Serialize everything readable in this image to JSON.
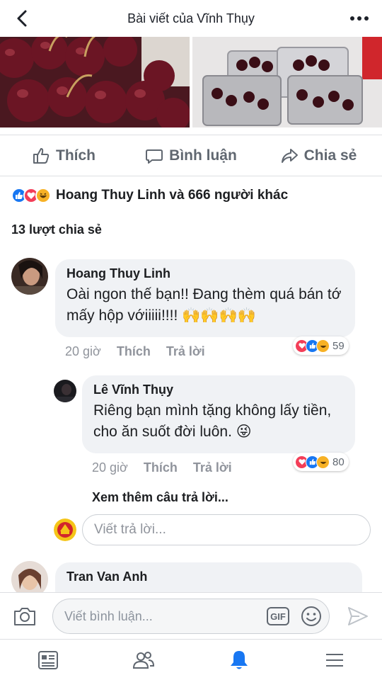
{
  "header": {
    "title": "Bài viết của Vĩnh Thụy"
  },
  "post": {
    "photos": [
      "cherries-closeup",
      "cherries-in-boxes"
    ],
    "actions": {
      "like_label": "Thích",
      "comment_label": "Bình luận",
      "share_label": "Chia sẻ"
    },
    "reactions_summary": "Hoang Thuy Linh và 666 người khác",
    "shares_text": "13 lượt chia sẻ"
  },
  "comments": [
    {
      "author": "Hoang Thuy Linh",
      "text": "Oài ngon thế bạn!! Đang thèm quá bán tớ mấy hộp vớiiiii!!!! 🙌🙌🙌🙌",
      "time": "20 giờ",
      "like_label": "Thích",
      "reply_label": "Trả lời",
      "reaction_count": "59",
      "replies": [
        {
          "author": "Lê Vĩnh Thụy",
          "text": "Riêng bạn mình tặng không lấy tiền, cho ăn suốt đời luôn. 😜",
          "time": "20 giờ",
          "like_label": "Thích",
          "reply_label": "Trả lời",
          "reaction_count": "80"
        }
      ],
      "see_more_replies": "Xem thêm câu trả lời...",
      "reply_placeholder": "Viết trả lời..."
    },
    {
      "author": "Tran Van Anh"
    }
  ],
  "composer": {
    "placeholder": "Viết bình luận...",
    "gif_label": "GIF"
  },
  "colors": {
    "like_blue": "#1877f2",
    "love_red": "#f33e58",
    "haha_yellow": "#f7b125",
    "notification_active": "#1877f2",
    "secondary_text": "#90949c"
  }
}
